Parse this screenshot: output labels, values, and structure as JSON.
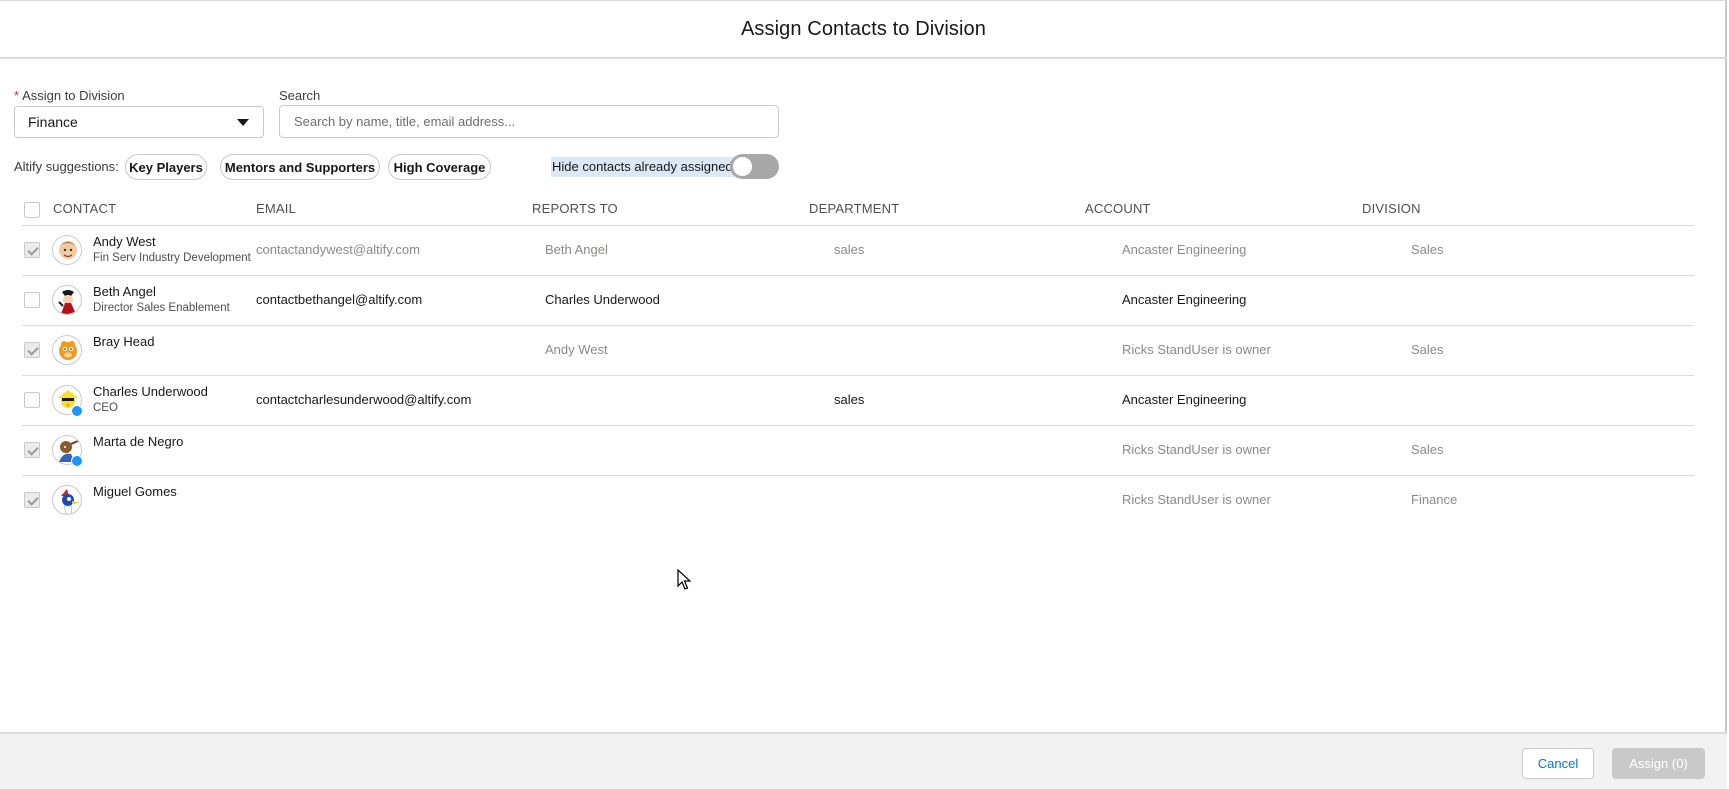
{
  "modal": {
    "title": "Assign Contacts to Division"
  },
  "form": {
    "required_marker": "*",
    "division_label": "Assign to Division",
    "division_value": "Finance",
    "search_label": "Search",
    "search_value": "",
    "search_placeholder": "Search by name, title, email address..."
  },
  "suggestions": {
    "label": "Altify suggestions:",
    "pills": [
      "Key Players",
      "Mentors and Supporters",
      "High Coverage"
    ]
  },
  "toggle": {
    "label": "Hide contacts already assigned",
    "on": false
  },
  "table": {
    "headers": [
      "CONTACT",
      "EMAIL",
      "REPORTS TO",
      "DEPARTMENT",
      "ACCOUNT",
      "DIVISION"
    ],
    "rows": [
      {
        "name": "Andy West",
        "title": "Fin Serv Industry Development",
        "email": "contactandywest@altify.com",
        "reports_to": "Beth Angel",
        "department": "sales",
        "account": "Ancaster Engineering",
        "division": "Sales",
        "assigned": true,
        "badge": false
      },
      {
        "name": "Beth Angel",
        "title": "Director Sales Enablement",
        "email": "contactbethangel@altify.com",
        "reports_to": "Charles Underwood",
        "department": "",
        "account": "Ancaster Engineering",
        "division": "",
        "assigned": false,
        "badge": false
      },
      {
        "name": "Bray Head",
        "title": "",
        "email": "",
        "reports_to": "Andy West",
        "department": "",
        "account": "Ricks StandUser is owner",
        "division": "Sales",
        "assigned": true,
        "badge": false
      },
      {
        "name": "Charles Underwood",
        "title": "CEO",
        "email": "contactcharlesunderwood@altify.com",
        "reports_to": "",
        "department": "sales",
        "account": "Ancaster Engineering",
        "division": "",
        "assigned": false,
        "badge": true
      },
      {
        "name": "Marta de Negro",
        "title": "",
        "email": "",
        "reports_to": "",
        "department": "",
        "account": "Ricks StandUser is owner",
        "division": "Sales",
        "assigned": true,
        "badge": true
      },
      {
        "name": "Miguel Gomes",
        "title": "",
        "email": "",
        "reports_to": "",
        "department": "",
        "account": "Ricks StandUser is owner",
        "division": "Finance",
        "assigned": true,
        "badge": false
      }
    ]
  },
  "footer": {
    "cancel_label": "Cancel",
    "assign_label": "Assign (0)"
  },
  "colors": {
    "brand": "#0176d3",
    "toggle_off": "#a8a8a8",
    "badge": "#1b96ff",
    "muted_text": "#8c8a87",
    "selection": "#dbe8f5"
  }
}
